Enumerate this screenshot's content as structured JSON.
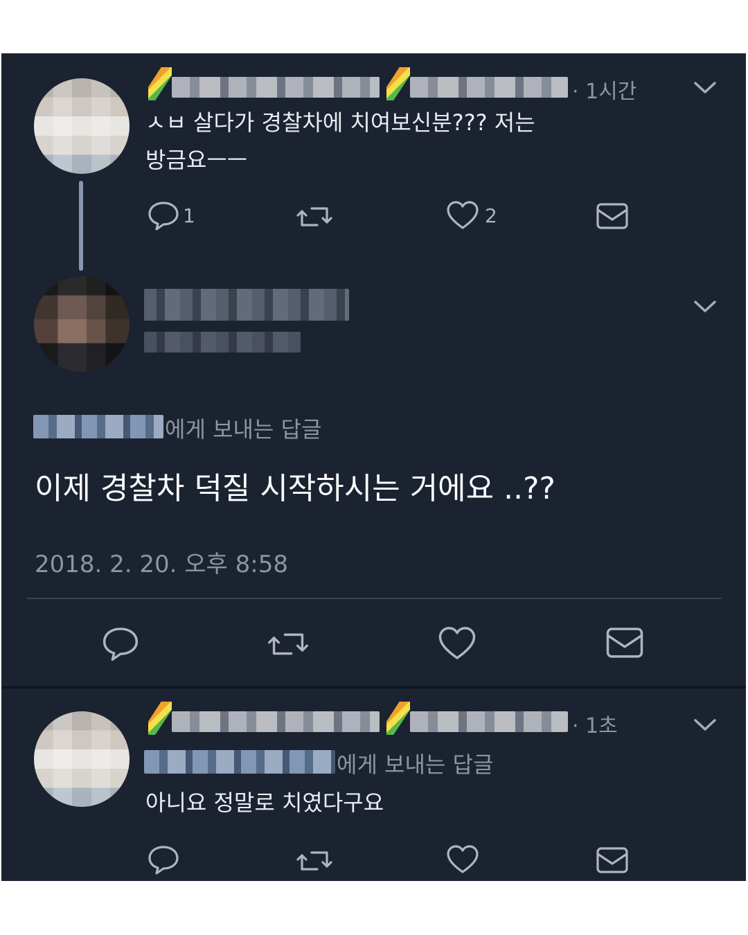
{
  "tweets": [
    {
      "time": "· 1시간",
      "text_line1": "ㅅㅂ 살다가 경찰차에 치여보신분??? 저는",
      "text_line2": "방금요ㅡㅡ",
      "actions": {
        "reply_count": "1",
        "like_count": "2"
      }
    },
    {
      "reply_to_suffix": "에게 보내는 답글",
      "text": "이제 경찰차 덕질 시작하시는 거에요 ..??",
      "timestamp": "2018. 2. 20. 오후 8:58"
    },
    {
      "time": "· 1초",
      "reply_to_suffix": "에게 보내는 답글",
      "text": "아니요 정말로 치였다구요"
    }
  ],
  "icons": [
    "reply-icon",
    "retweet-icon",
    "like-icon",
    "message-icon",
    "chevron-down-icon"
  ],
  "colors": {
    "background": "#1b2230",
    "text": "#e9ecf1",
    "muted": "#8c95a3"
  }
}
